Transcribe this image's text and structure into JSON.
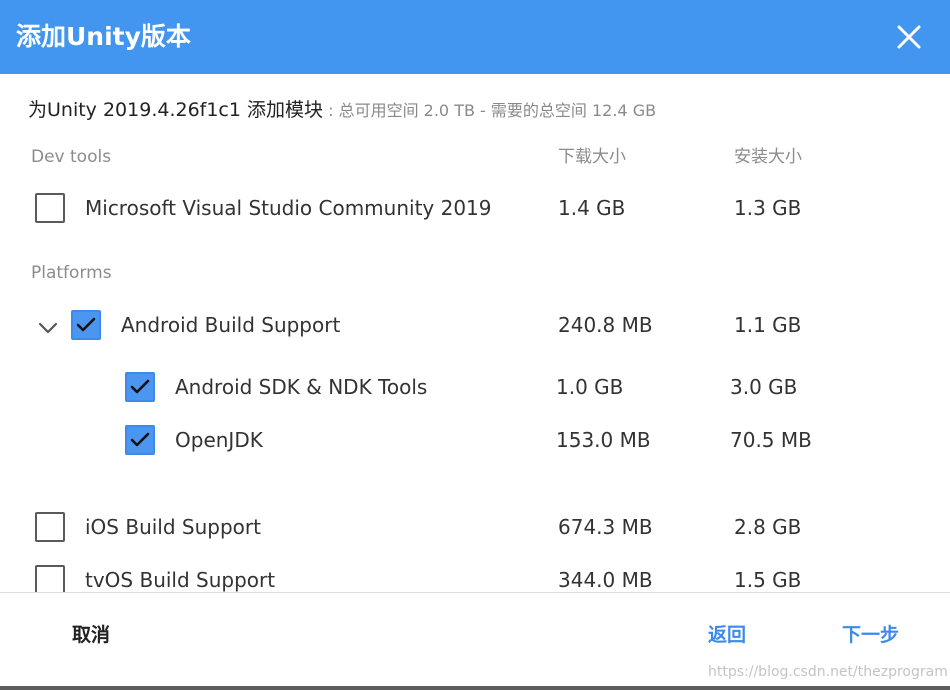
{
  "window": {
    "title": "添加Unity版本"
  },
  "colors": {
    "header_bg": "#4396f0",
    "accent": "#3d8ae8",
    "checkbox_checked": "#4a96f0"
  },
  "subtitle": {
    "main": "为Unity 2019.4.26f1c1 添加模块",
    "info": " : 总可用空间 2.0 TB - 需要的总空间 12.4 GB"
  },
  "columns": {
    "download_size": "下载大小",
    "install_size": "安装大小"
  },
  "sections": {
    "dev_tools": "Dev tools",
    "platforms": "Platforms"
  },
  "modules": {
    "vs": {
      "name": "Microsoft Visual Studio Community 2019",
      "download": "1.4 GB",
      "install": "1.3 GB",
      "checked": false
    },
    "android": {
      "name": "Android Build Support",
      "download": "240.8 MB",
      "install": "1.1 GB",
      "checked": true,
      "expanded": true
    },
    "android_sdk": {
      "name": "Android SDK & NDK Tools",
      "download": "1.0 GB",
      "install": "3.0 GB",
      "checked": true
    },
    "openjdk": {
      "name": "OpenJDK",
      "download": "153.0 MB",
      "install": "70.5 MB",
      "checked": true
    },
    "ios": {
      "name": "iOS Build Support",
      "download": "674.3 MB",
      "install": "2.8 GB",
      "checked": false
    },
    "tvos": {
      "name": "tvOS Build Support",
      "download": "344.0 MB",
      "install": "1.5 GB",
      "checked": false
    }
  },
  "footer": {
    "cancel": "取消",
    "back": "返回",
    "next": "下一步",
    "watermark": "https://blog.csdn.net/thezprogram"
  }
}
